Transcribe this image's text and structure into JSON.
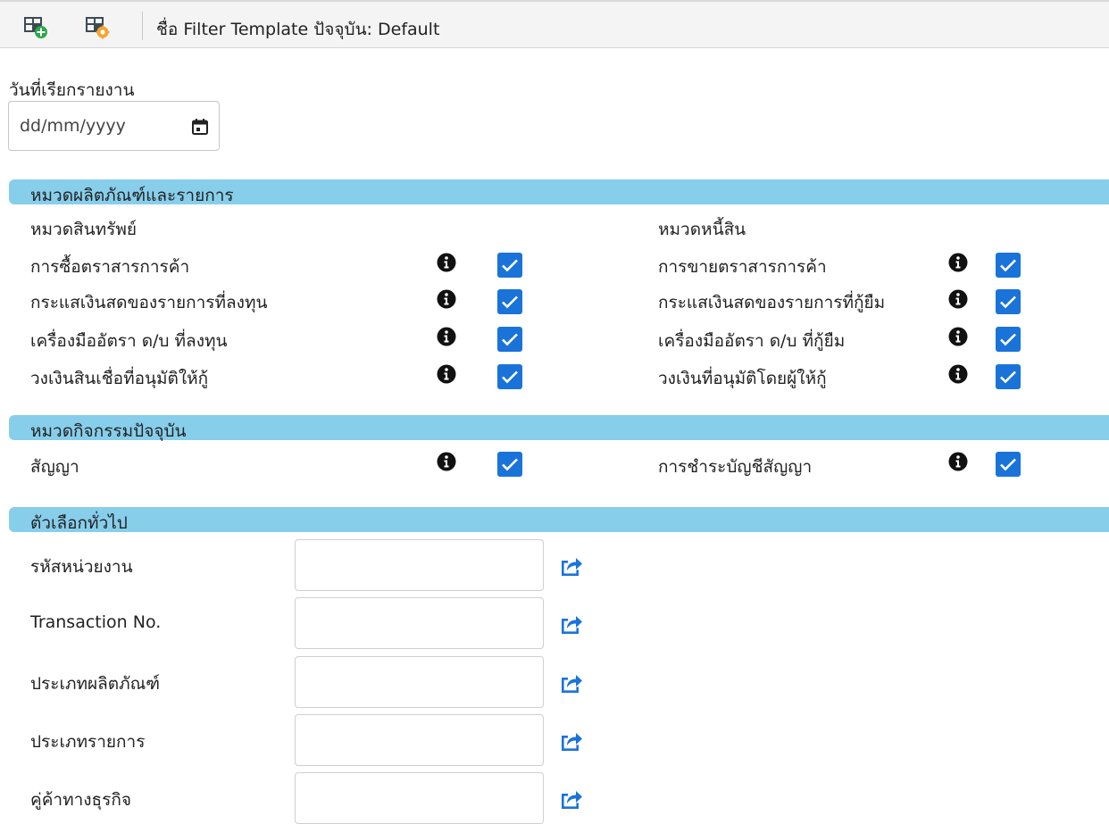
{
  "toolbar": {
    "template_title": "ชื่อ Filter Template ปัจจุบัน: Default",
    "icons": [
      "add-table-icon",
      "table-settings-icon"
    ]
  },
  "report_date": {
    "label": "วันที่เรียกรายงาน",
    "placeholder": "dd/mm/yyyy",
    "value": ""
  },
  "product_section": {
    "title": "หมวดผลิตภัณฑ์และรายการ",
    "assets": {
      "title": "หมวดสินทรัพย์",
      "items": [
        {
          "label": "การซื้อตราสารการค้า",
          "checked": true
        },
        {
          "label": "กระแสเงินสดของรายการที่ลงทุน",
          "checked": true
        },
        {
          "label": "เครื่องมืออัตรา ด/บ ที่ลงทุน",
          "checked": true
        },
        {
          "label": "วงเงินสินเชื่อที่อนุมัติให้กู้",
          "checked": true
        }
      ]
    },
    "liabilities": {
      "title": "หมวดหนี้สิน",
      "items": [
        {
          "label": "การขายตราสารการค้า",
          "checked": true
        },
        {
          "label": "กระแสเงินสดของรายการที่กู้ยืม",
          "checked": true
        },
        {
          "label": "เครื่องมืออัตรา ด/บ ที่กู้ยืม",
          "checked": true
        },
        {
          "label": "วงเงินที่อนุมัติโดยผู้ให้กู้",
          "checked": true
        }
      ]
    }
  },
  "activity_section": {
    "title": "หมวดกิจกรรมปัจจุบัน",
    "items": [
      {
        "label": "สัญญา",
        "checked": true
      },
      {
        "label": "การชำระบัญชีสัญญา",
        "checked": true
      }
    ]
  },
  "general_section": {
    "title": "ตัวเลือกทั่วไป",
    "fields": [
      {
        "label": "รหัสหน่วยงาน",
        "value": ""
      },
      {
        "label": "Transaction No.",
        "value": ""
      },
      {
        "label": "ประเภทผลิตภัณฑ์",
        "value": ""
      },
      {
        "label": "ประเภทรายการ",
        "value": ""
      },
      {
        "label": "คู่ค้าทางธุรกิจ",
        "value": ""
      }
    ]
  },
  "colors": {
    "section_bar": "#87ceeb",
    "checkbox": "#1a73d9",
    "pick_icon": "#1a73d9"
  }
}
